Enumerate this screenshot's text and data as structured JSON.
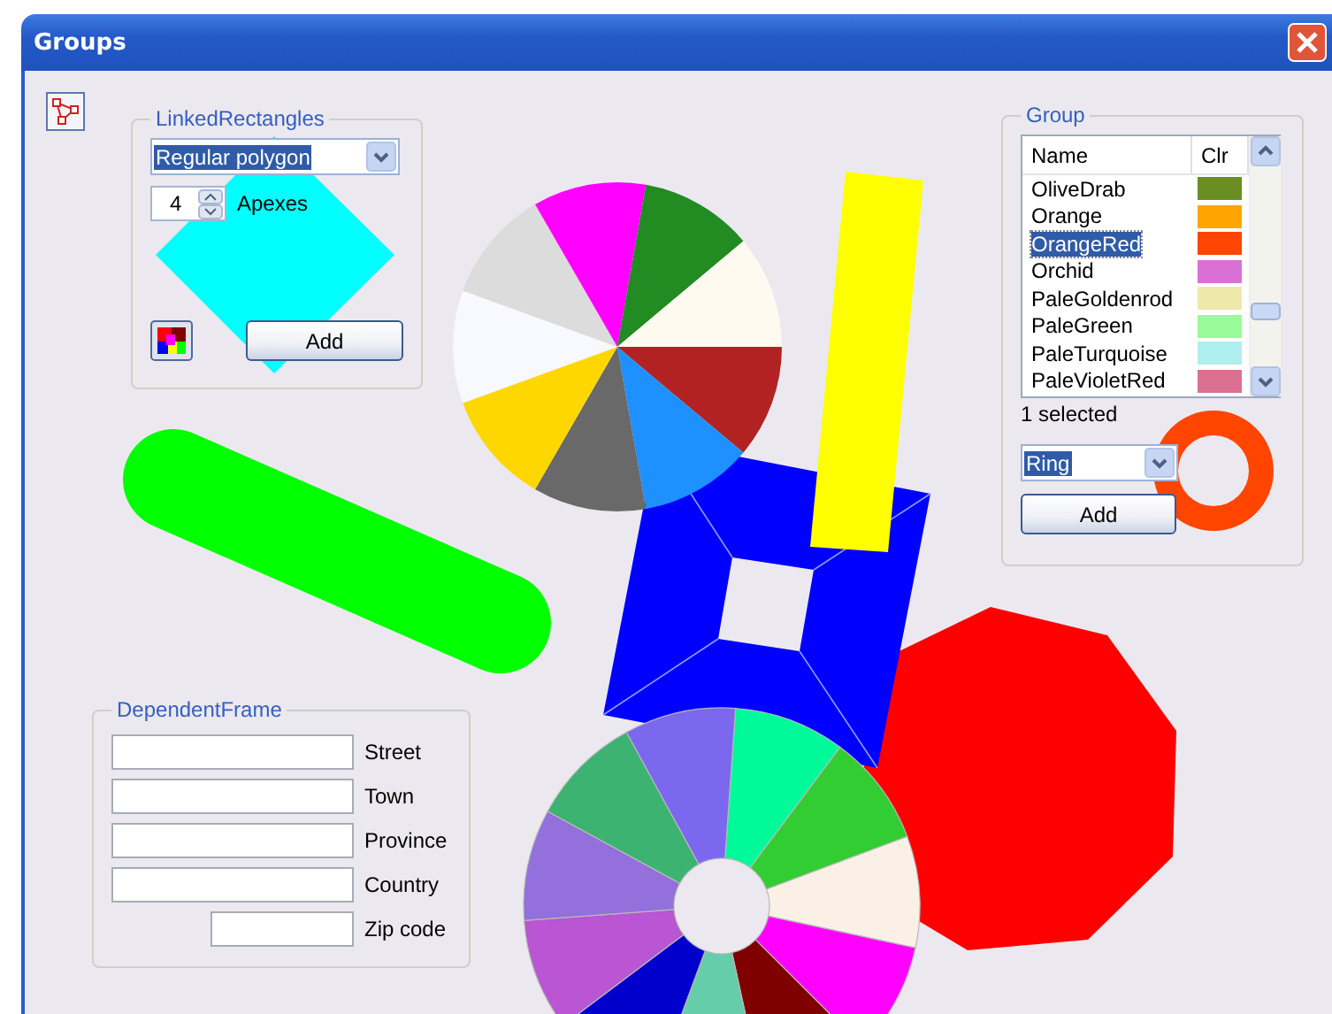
{
  "window": {
    "title": "Groups"
  },
  "linked_rectangles": {
    "title": "LinkedRectangles",
    "shape_select": {
      "value": "Regular polygon"
    },
    "apexes": {
      "value": "4",
      "label": "Apexes"
    },
    "add_button": "Add"
  },
  "group": {
    "title": "Group",
    "columns": [
      "Name",
      "Clr"
    ],
    "rows": [
      {
        "name": "OliveDrab",
        "color": "#6b8e23",
        "selected": false
      },
      {
        "name": "Orange",
        "color": "#ffa500",
        "selected": false
      },
      {
        "name": "OrangeRed",
        "color": "#ff4500",
        "selected": true
      },
      {
        "name": "Orchid",
        "color": "#da70d6",
        "selected": false
      },
      {
        "name": "PaleGoldenrod",
        "color": "#eee8aa",
        "selected": false
      },
      {
        "name": "PaleGreen",
        "color": "#98fb98",
        "selected": false
      },
      {
        "name": "PaleTurquoise",
        "color": "#afeeee",
        "selected": false
      },
      {
        "name": "PaleVioletRed",
        "color": "#db7093",
        "selected": false
      }
    ],
    "selection_count": "1 selected",
    "shape_select": {
      "value": "Ring"
    },
    "add_button": "Add"
  },
  "dependent_frame": {
    "title": "DependentFrame",
    "fields": [
      {
        "label": "Street",
        "kind": "long"
      },
      {
        "label": "Town",
        "kind": "long"
      },
      {
        "label": "Province",
        "kind": "long"
      },
      {
        "label": "Country",
        "kind": "long"
      },
      {
        "label": "Zip code",
        "kind": "short"
      }
    ]
  }
}
